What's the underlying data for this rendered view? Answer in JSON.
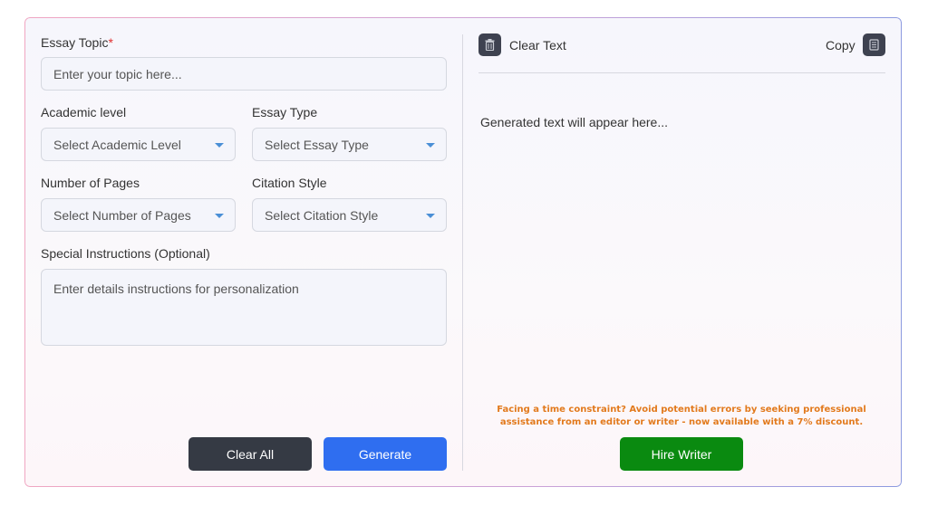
{
  "form": {
    "topic_label": "Essay Topic",
    "topic_required_mark": "*",
    "topic_placeholder": "Enter your topic here...",
    "academic_label": "Academic level",
    "academic_value": "Select Academic Level",
    "essay_type_label": "Essay Type",
    "essay_type_value": "Select Essay Type",
    "pages_label": "Number of Pages",
    "pages_value": "Select Number of Pages",
    "citation_label": "Citation Style",
    "citation_value": "Select Citation Style",
    "instructions_label": "Special Instructions (Optional)",
    "instructions_placeholder": "Enter details instructions for personalization",
    "clear_all_label": "Clear All",
    "generate_label": "Generate"
  },
  "output": {
    "clear_text_label": "Clear Text",
    "copy_label": "Copy",
    "placeholder": "Generated text will appear here...",
    "promo_text": "Facing a time constraint? Avoid potential errors by seeking professional assistance from an editor or writer - now available with a 7% discount.",
    "hire_label": "Hire Writer"
  },
  "icons": {
    "clear": "trash-icon",
    "copy": "clipboard-icon",
    "dropdown": "caret-down-icon"
  },
  "colors": {
    "clear_all_bg": "#353a44",
    "generate_bg": "#2f6ef0",
    "hire_bg": "#0a8a10",
    "promo_text": "#e27a1d",
    "required_mark": "#e03030",
    "dropdown_caret": "#4a8fd6"
  }
}
